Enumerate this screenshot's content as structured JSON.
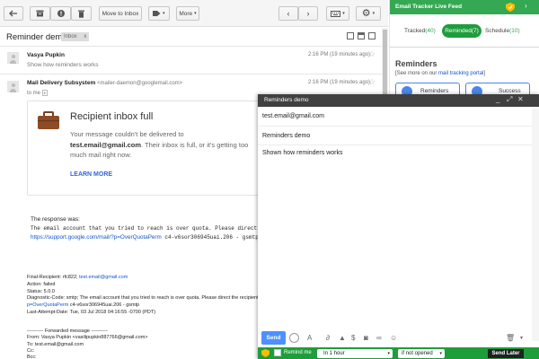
{
  "toolbar": {
    "move_to_inbox": "Move to Inbox",
    "more": "More"
  },
  "thread": {
    "subject": "Reminder demo",
    "label": "Inbox",
    "label_close": "x"
  },
  "msg1": {
    "sender": "Vasya Pupkin",
    "time": "2:16 PM (19 minutes ago)",
    "snippet": "Show how reminders works"
  },
  "msg2": {
    "sender": "Mail Delivery Subsystem",
    "sender_email": "<mailer-daemon@googlemail.com>",
    "time": "2:16 PM (19 minutes ago)",
    "to": "to me"
  },
  "bounce": {
    "title": "Recipient inbox full",
    "line1": "Your message couldn't be delivered to",
    "address": "test.email@gmail.com",
    "line2": ". Their inbox is full, or it's getting too",
    "line3": "much mail right now.",
    "learn_more": "LEARN MORE"
  },
  "response": {
    "label": "The response was:",
    "line1": "The email account that you tried to reach is over quota. Please direct the",
    "link": "https://support.google.com/mail/?p=OverQuotaPerm",
    "line2_rest": " c4-v6sor306945uai.206 - gsmtp"
  },
  "details": {
    "final_recipient_label": "Final-Recipient: rfc822;",
    "final_recipient": "test.email@gmail.com",
    "action": "Action: failed",
    "status": "Status: 5.0.0",
    "diagnostic": "Diagnostic-Code: smtp; The email account that you tried to reach is over quota. Please direct the recipient",
    "diagnostic2_link": "p=OverQuotaPerm",
    "diagnostic2_rest": " c4-v6sor306945uai.206 - gsmtp",
    "last_attempt": "Last-Attempt-Date: Tue, 03 Jul 2018 04:16:55 -0700 (PDT)"
  },
  "forwarded": {
    "header": "---------- Forwarded message ----------",
    "from": "From: Vasya Pupkin <vasilipupkin887766@gmail.com>",
    "to": "To: test.email@gmail.com",
    "cc": "Cc:",
    "bcc": "Bcc:"
  },
  "sidebar": {
    "title": "Email Tracker Live Feed",
    "tabs": [
      {
        "label": "Tracked",
        "count": "(40)"
      },
      {
        "label": "Reminded",
        "count": "(7)"
      },
      {
        "label": "Schedule",
        "count": "(10)"
      }
    ],
    "reminders_title": "Reminders",
    "reminders_sub_pre": "[See more on our ",
    "reminders_sub_link": "mail tracking portal",
    "reminders_sub_post": "]",
    "card1": "Reminders",
    "card2": "Success",
    "colors": {
      "green": "#34a853",
      "active_tab": "#1e9d3c",
      "blue": "#4a86e8"
    }
  },
  "compose": {
    "title": "Reminders demo",
    "to": "test.email@gmail.com",
    "subject": "Reminders demo",
    "body": "Shown how reminders works",
    "send": "Send",
    "send_later": "Send Later",
    "reminder": {
      "label": "Remind me",
      "time": "In 1 hour",
      "condition": "if not opened"
    },
    "colors": {
      "header": "#404040",
      "send": "#4d90fe",
      "reminder_bar": "#1e9e3a"
    }
  }
}
